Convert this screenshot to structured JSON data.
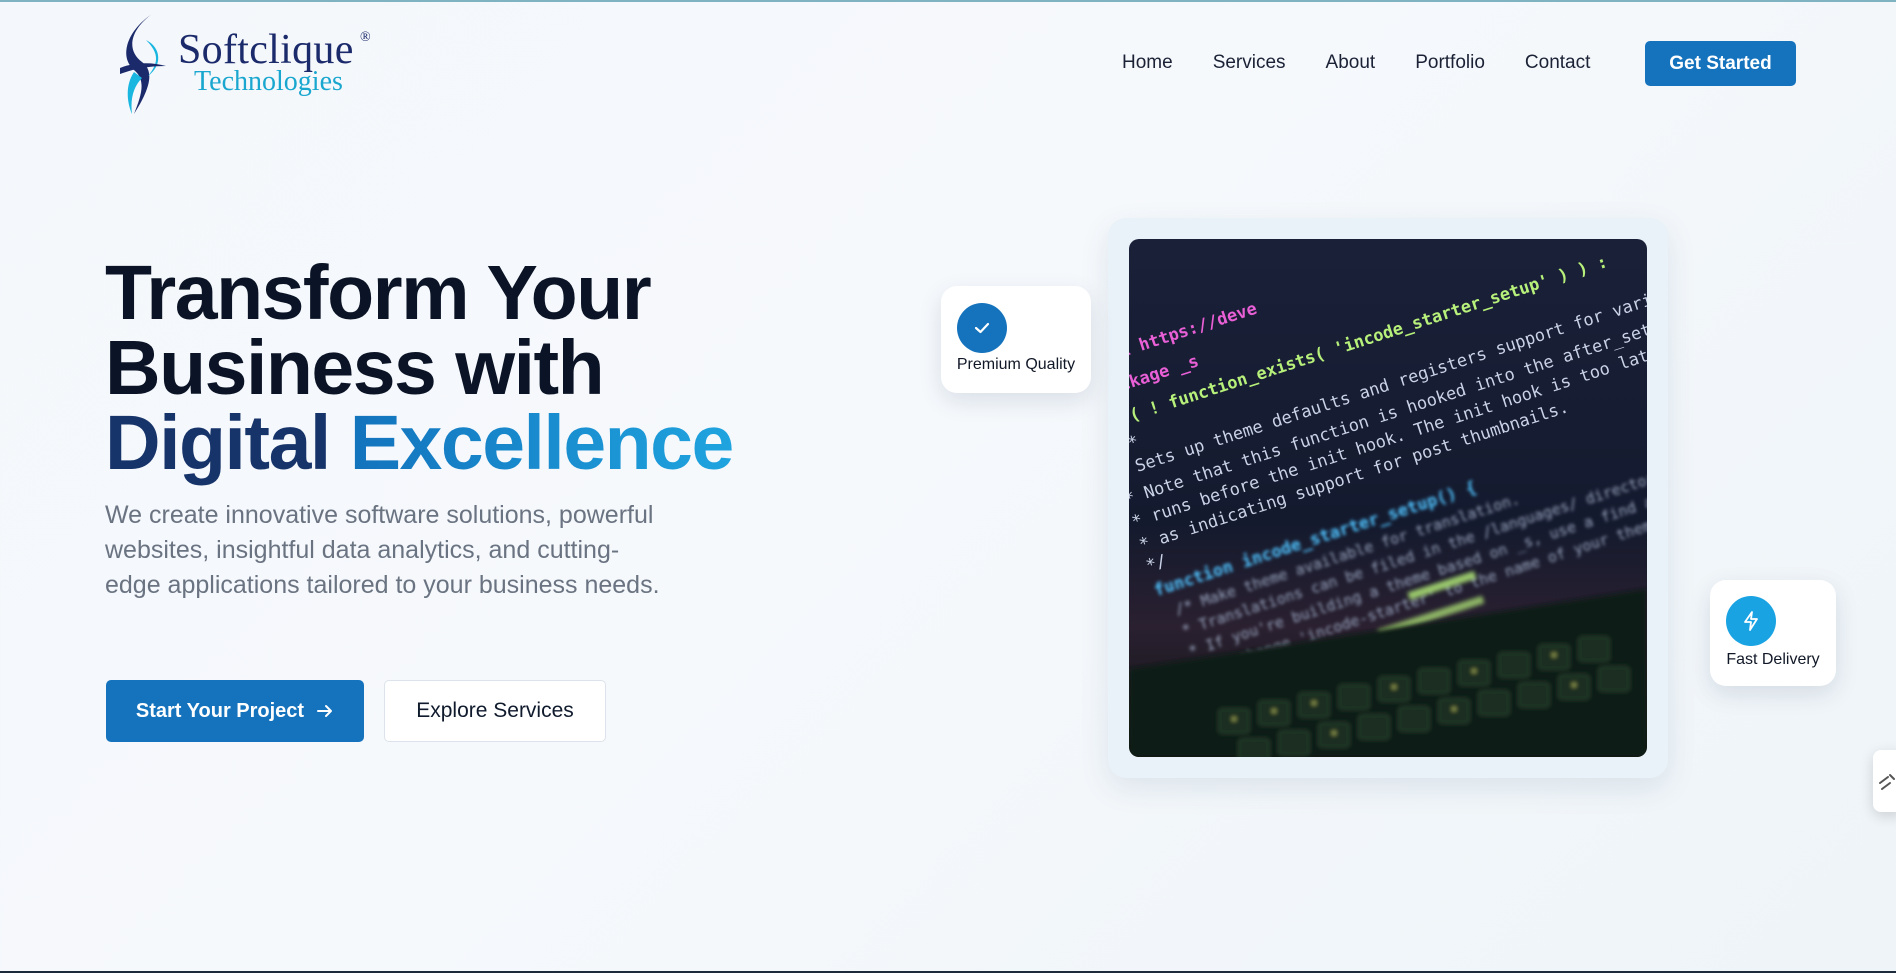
{
  "brand": {
    "name": "Softclique",
    "registered_mark": "®",
    "subtitle": "Technologies",
    "colors": {
      "primary": "#1573bd",
      "accent": "#1fa4df",
      "dark": "#0b1426"
    }
  },
  "nav": {
    "items": [
      {
        "label": "Home"
      },
      {
        "label": "Services"
      },
      {
        "label": "About"
      },
      {
        "label": "Portfolio"
      },
      {
        "label": "Contact"
      }
    ],
    "cta_label": "Get Started"
  },
  "hero": {
    "title_line1": "Transform Your",
    "title_line2": "Business with",
    "title_line3_a": "Digital",
    "title_line3_b": "Excellence",
    "description": "We create innovative software solutions, powerful websites, insightful data analytics, and cutting-edge applications tailored to your business needs.",
    "primary_button": "Start Your Project",
    "primary_button_icon": "arrow-right-icon",
    "secondary_button": "Explore Services"
  },
  "badges": {
    "quality": {
      "label": "Premium Quality",
      "icon": "check-icon"
    },
    "delivery": {
      "label": "Fast Delivery",
      "icon": "lightning-icon"
    }
  },
  "code_image": {
    "lines": [
      "@link https://deve",
      "@package _s",
      "if ( ! function_exists( 'incode_starter_setup' ) ) :",
      "/**",
      " * Sets up theme defaults and registers support for various",
      " * Note that this function is hooked into the after_setup_theme",
      " * runs before the init hook. The init hook is too late for s",
      " * as indicating support for post thumbnails.",
      " */",
      "function incode_starter_setup() {",
      "  /* Make theme available for translation.",
      "   * Translations can be filed in the /languages/ directory.",
      "   * If you're building a theme based on _s, use a find and",
      "   * to change 'incode-starter' to the name of your theme"
    ]
  }
}
